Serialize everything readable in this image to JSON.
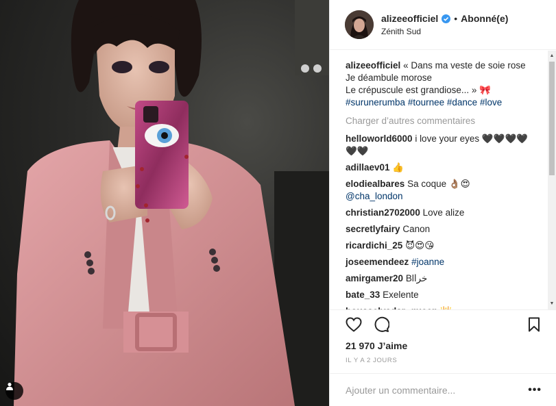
{
  "post": {
    "username": "alizeeofficiel",
    "follow_status": "Abonné(e)",
    "dot": "•",
    "location": "Zénith Sud"
  },
  "caption": {
    "username": "alizeeofficiel",
    "line1": "« Dans ma veste de soie rose",
    "line2": "Je déambule morose",
    "line3": "Le crépuscule est grandiose... »",
    "emoji": "🎀",
    "hashtags": [
      "#surunerumba",
      "#tournee",
      "#dance",
      "#love"
    ]
  },
  "load_more_label": "Charger d’autres commentaires",
  "comments": [
    {
      "username": "helloworld6000",
      "text": "i love your eyes 🖤🖤🖤🖤🖤🖤"
    },
    {
      "username": "adillaev01",
      "text": "👍"
    },
    {
      "username": "elodiealbares",
      "text": "Sa coque 👌🏽😍",
      "mention": "@cha_london"
    },
    {
      "username": "christian2702000",
      "text": "Love alize"
    },
    {
      "username": "secretlyfairy",
      "text": "Canon"
    },
    {
      "username": "ricardichi_25",
      "text": "😈😍😘"
    },
    {
      "username": "joseemendeez",
      "text": "",
      "tag": "#joanne"
    },
    {
      "username": "amirgamer20",
      "text": "Blخرا"
    },
    {
      "username": "bate_33",
      "text": "Exelente"
    },
    {
      "username": "bousselyadar_queen",
      "text": "👑"
    }
  ],
  "icons": {
    "like": "heart-outline-icon",
    "comment": "speech-bubble-icon",
    "save": "bookmark-icon",
    "verified": "verified-badge-icon",
    "tagged": "user-tag-icon"
  },
  "likes_text": "21 970 J’aime",
  "timestamp": "IL Y A 2 JOURS",
  "add_comment": {
    "placeholder": "Ajouter un commentaire..."
  },
  "more_label": "•••",
  "colors": {
    "link": "#003569",
    "muted": "#999999",
    "verified": "#3897f0",
    "jacket": "#d9969a"
  }
}
